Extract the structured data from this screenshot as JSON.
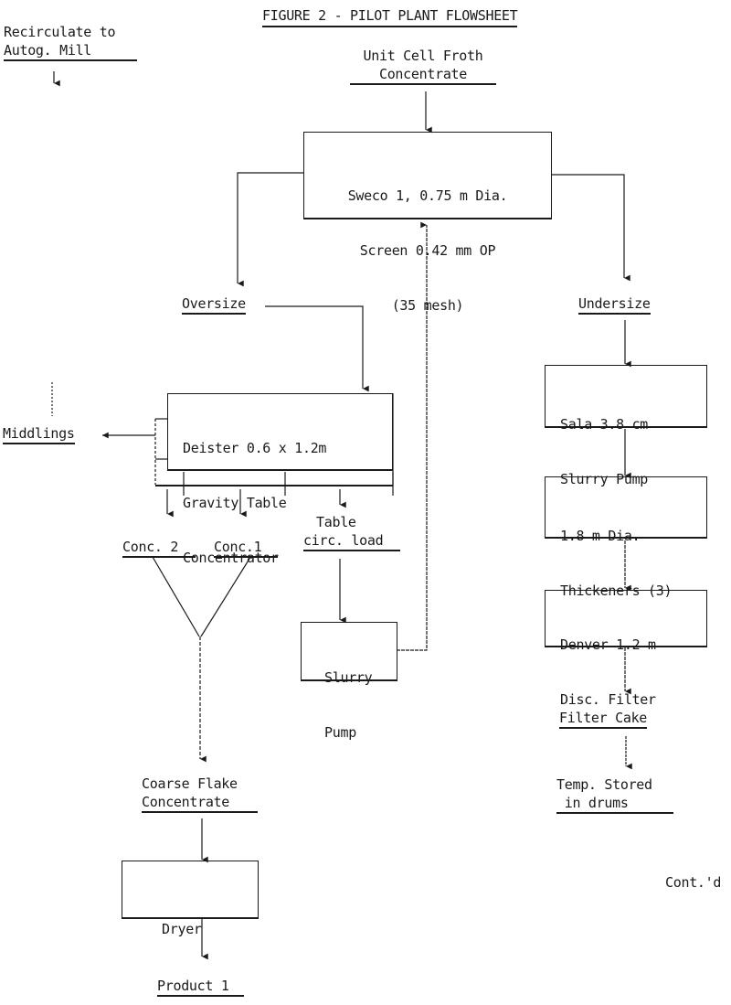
{
  "figure": {
    "title": "FIGURE 2 - PILOT PLANT FLOWSHEET",
    "continued_note": "Cont.'d"
  },
  "labels": {
    "recirculate": [
      "Recirculate to",
      "Autog. Mill"
    ],
    "feed": [
      "Unit Cell Froth",
      "Concentrate"
    ],
    "oversize": "Oversize",
    "undersize": "Undersize",
    "middlings": "Middlings",
    "conc2": "Conc. 2",
    "conc1": "Conc.1",
    "table_circ": [
      "Table",
      "circ. load"
    ],
    "coarse_flake": [
      "Coarse Flake",
      "Concentrate"
    ],
    "product1": "Product 1",
    "filter_cake": "Filter Cake",
    "temp_stored": [
      "Temp. Stored",
      " in drums"
    ]
  },
  "units": {
    "sweco": [
      "Sweco 1, 0.75 m Dia.",
      "Screen 0.42 mm OP",
      "(35 mesh)"
    ],
    "deister": [
      "Deister 0.6 x 1.2m",
      "Gravity Table",
      "Concentrator"
    ],
    "slurry_pump_small": [
      "Slurry",
      "Pump"
    ],
    "sala_pump": [
      "Sala 3.8 cm",
      "Slurry Pump"
    ],
    "thickeners": [
      "1.8 m Dia.",
      "Thickeners (3)"
    ],
    "disc_filter": [
      "Denver 1.2 m",
      "Disc. Filter"
    ],
    "dryer": [
      "Dryer"
    ]
  },
  "flows": [
    {
      "from": "Unit Cell Froth Concentrate",
      "to": "Sweco 1 Screen"
    },
    {
      "from": "Sweco 1 Screen",
      "to": "Oversize"
    },
    {
      "from": "Sweco 1 Screen",
      "to": "Undersize"
    },
    {
      "from": "Oversize",
      "to": "Deister Gravity Table"
    },
    {
      "from": "Deister Gravity Table",
      "to": "Middlings"
    },
    {
      "from": "Deister Gravity Table",
      "to": "Conc. 2"
    },
    {
      "from": "Deister Gravity Table",
      "to": "Conc.1"
    },
    {
      "from": "Deister Gravity Table",
      "to": "Table circ. load"
    },
    {
      "from": "Table circ. load",
      "to": "Slurry Pump"
    },
    {
      "from": "Slurry Pump",
      "to": "Sweco 1 Screen"
    },
    {
      "from": "Conc. 2",
      "to": "Coarse Flake Concentrate"
    },
    {
      "from": "Conc.1",
      "to": "Coarse Flake Concentrate"
    },
    {
      "from": "Coarse Flake Concentrate",
      "to": "Dryer"
    },
    {
      "from": "Dryer",
      "to": "Product 1"
    },
    {
      "from": "Undersize",
      "to": "Sala Slurry Pump"
    },
    {
      "from": "Sala Slurry Pump",
      "to": "Thickeners"
    },
    {
      "from": "Thickeners",
      "to": "Disc Filter"
    },
    {
      "from": "Disc Filter",
      "to": "Filter Cake"
    },
    {
      "from": "Filter Cake",
      "to": "Temp. Stored in drums"
    }
  ]
}
